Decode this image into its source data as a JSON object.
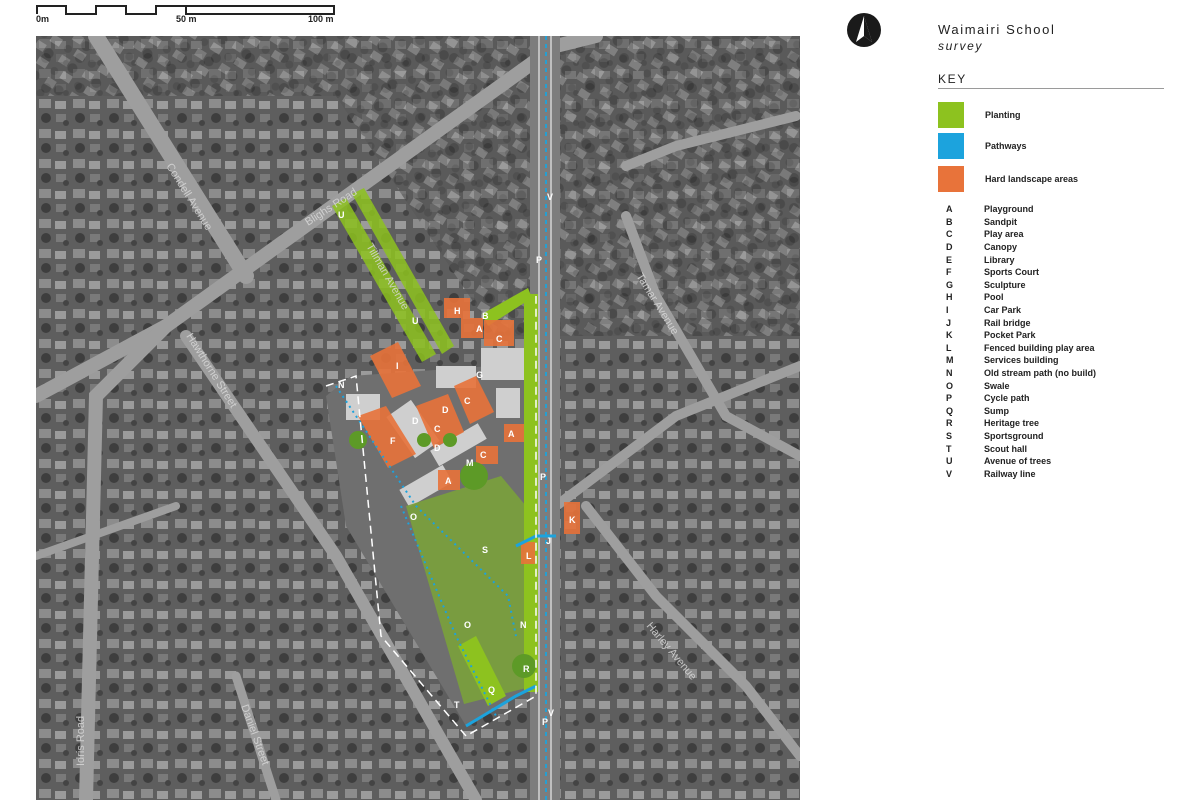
{
  "scale_bar": {
    "labels": [
      "0m",
      "50 m",
      "100 m"
    ]
  },
  "title": "Waimairi School",
  "subtitle": "survey",
  "key_heading": "KEY",
  "colors": {
    "planting": "#8dc21f",
    "pathways": "#1ca3dd",
    "hard_landscape": "#e8733a"
  },
  "key_swatches": [
    {
      "label": "Planting",
      "color": "#8dc21f"
    },
    {
      "label": "Pathways",
      "color": "#1ca3dd"
    },
    {
      "label": "Hard landscape areas",
      "color": "#e8733a"
    }
  ],
  "legend": [
    {
      "code": "A",
      "label": "Playground"
    },
    {
      "code": "B",
      "label": "Sandpit"
    },
    {
      "code": "C",
      "label": "Play area"
    },
    {
      "code": "D",
      "label": "Canopy"
    },
    {
      "code": "E",
      "label": "Library"
    },
    {
      "code": "F",
      "label": "Sports Court"
    },
    {
      "code": "G",
      "label": "Sculpture"
    },
    {
      "code": "H",
      "label": "Pool"
    },
    {
      "code": "I",
      "label": "Car Park"
    },
    {
      "code": "J",
      "label": "Rail bridge"
    },
    {
      "code": "K",
      "label": "Pocket Park"
    },
    {
      "code": "L",
      "label": "Fenced building play area"
    },
    {
      "code": "M",
      "label": "Services building"
    },
    {
      "code": "N",
      "label": "Old stream path (no build)"
    },
    {
      "code": "O",
      "label": "Swale"
    },
    {
      "code": "P",
      "label": "Cycle path"
    },
    {
      "code": "Q",
      "label": "Sump"
    },
    {
      "code": "R",
      "label": "Heritage tree"
    },
    {
      "code": "S",
      "label": "Sportsground"
    },
    {
      "code": "T",
      "label": "Scout hall"
    },
    {
      "code": "U",
      "label": "Avenue of trees"
    },
    {
      "code": "V",
      "label": "Railway line"
    }
  ],
  "street_labels": [
    "Condell Avenue",
    "Blighs Road",
    "Tillman Avenue",
    "Hawthorne Street",
    "Tamar Avenue",
    "Harley Avenue",
    "Idris Road",
    "Daniel Street"
  ]
}
